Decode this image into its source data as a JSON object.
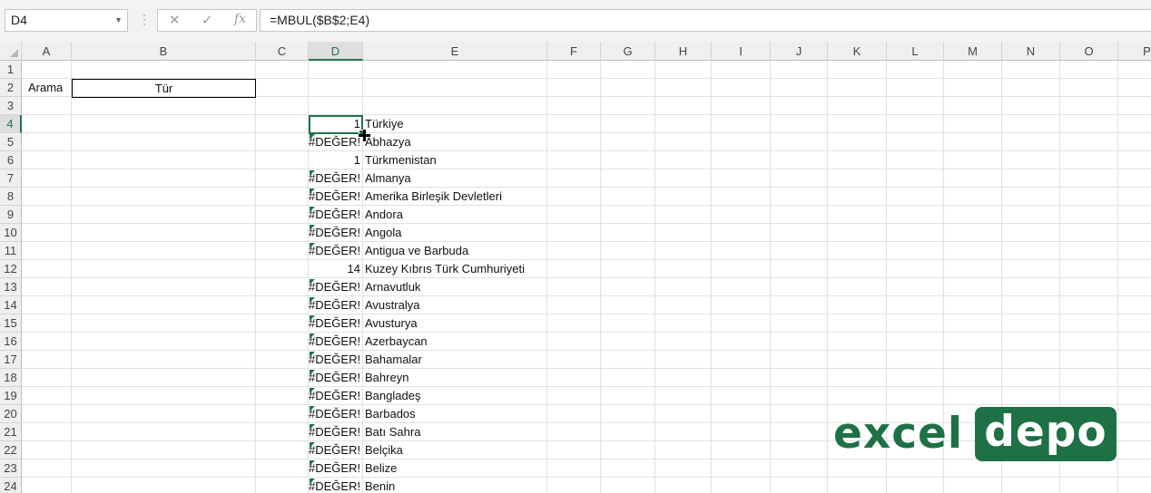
{
  "formula_bar": {
    "name_box": "D4",
    "cancel_icon": "✕",
    "enter_icon": "✓",
    "fx_label": "fx",
    "formula": "=MBUL($B$2;E4)"
  },
  "columns": [
    "A",
    "B",
    "C",
    "D",
    "E",
    "F",
    "G",
    "H",
    "I",
    "J",
    "K",
    "L",
    "M",
    "N",
    "O",
    "P"
  ],
  "active_column": "D",
  "rows": [
    "1",
    "2",
    "3",
    "4",
    "5",
    "6",
    "7",
    "8",
    "9",
    "10",
    "11",
    "12",
    "13",
    "14",
    "15",
    "16",
    "17",
    "18",
    "19",
    "20",
    "21",
    "22",
    "23",
    "24"
  ],
  "active_row": "4",
  "cells": {
    "a2": "Arama",
    "b2": "Tür"
  },
  "data_rows": [
    {
      "row": "4",
      "d": "1",
      "e": "Türkiye",
      "error": false
    },
    {
      "row": "5",
      "d": "#DEĞER!",
      "e": "Abhazya",
      "error": true
    },
    {
      "row": "6",
      "d": "1",
      "e": "Türkmenistan",
      "error": false
    },
    {
      "row": "7",
      "d": "#DEĞER!",
      "e": "Almanya",
      "error": true
    },
    {
      "row": "8",
      "d": "#DEĞER!",
      "e": "Amerika Birleşik Devletleri",
      "error": true
    },
    {
      "row": "9",
      "d": "#DEĞER!",
      "e": "Andora",
      "error": true
    },
    {
      "row": "10",
      "d": "#DEĞER!",
      "e": "Angola",
      "error": true
    },
    {
      "row": "11",
      "d": "#DEĞER!",
      "e": "Antigua ve Barbuda",
      "error": true
    },
    {
      "row": "12",
      "d": "14",
      "e": "Kuzey Kıbrıs Türk Cumhuriyeti",
      "error": false
    },
    {
      "row": "13",
      "d": "#DEĞER!",
      "e": "Arnavutluk",
      "error": true
    },
    {
      "row": "14",
      "d": "#DEĞER!",
      "e": "Avustralya",
      "error": true
    },
    {
      "row": "15",
      "d": "#DEĞER!",
      "e": "Avusturya",
      "error": true
    },
    {
      "row": "16",
      "d": "#DEĞER!",
      "e": "Azerbaycan",
      "error": true
    },
    {
      "row": "17",
      "d": "#DEĞER!",
      "e": "Bahamalar",
      "error": true
    },
    {
      "row": "18",
      "d": "#DEĞER!",
      "e": "Bahreyn",
      "error": true
    },
    {
      "row": "19",
      "d": "#DEĞER!",
      "e": "Bangladeş",
      "error": true
    },
    {
      "row": "20",
      "d": "#DEĞER!",
      "e": "Barbados",
      "error": true
    },
    {
      "row": "21",
      "d": "#DEĞER!",
      "e": "Batı Sahra",
      "error": true
    },
    {
      "row": "22",
      "d": "#DEĞER!",
      "e": "Belçika",
      "error": true
    },
    {
      "row": "23",
      "d": "#DEĞER!",
      "e": "Belize",
      "error": true
    },
    {
      "row": "24",
      "d": "#DEĞER!",
      "e": "Benin",
      "error": true
    }
  ],
  "logo": {
    "part1": "excel",
    "part2": "depo"
  },
  "colors": {
    "accent": "#217346",
    "error_indicator": "#1e7145",
    "logo_green": "#1e7145"
  }
}
